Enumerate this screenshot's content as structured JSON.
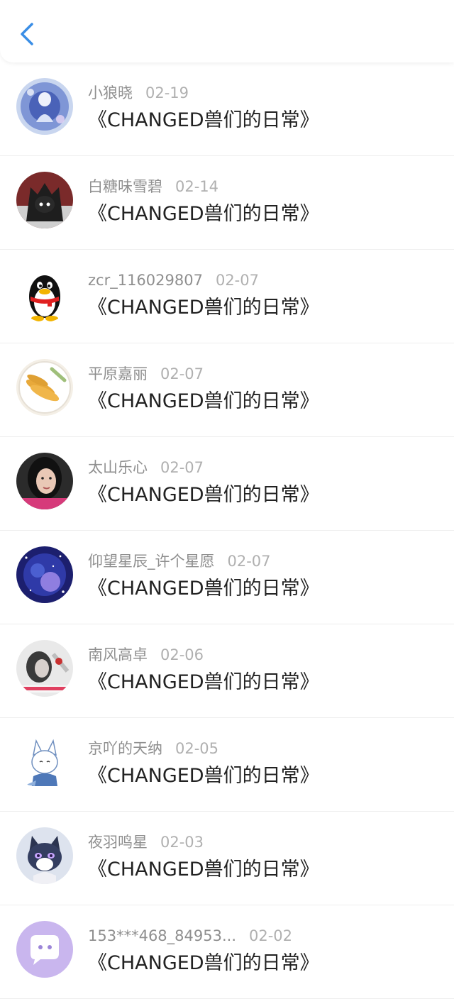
{
  "header": {
    "back_icon": "chevron-left-icon",
    "accent_color": "#3a8ee6"
  },
  "items": [
    {
      "name": "小狼晓",
      "date": "02-19",
      "title": "《CHANGED兽们的日常》",
      "avatar": "fantasy-character-avatar"
    },
    {
      "name": "白糖味雪碧",
      "date": "02-14",
      "title": "《CHANGED兽们的日常》",
      "avatar": "dark-creature-avatar"
    },
    {
      "name": "zcr_116029807",
      "date": "02-07",
      "title": "《CHANGED兽们的日常》",
      "avatar": "penguin-avatar"
    },
    {
      "name": "平原嘉丽",
      "date": "02-07",
      "title": "《CHANGED兽们的日常》",
      "avatar": "food-plate-avatar"
    },
    {
      "name": "太山乐心",
      "date": "02-07",
      "title": "《CHANGED兽们的日常》",
      "avatar": "portrait-photo-avatar"
    },
    {
      "name": "仰望星辰_许个星愿",
      "date": "02-07",
      "title": "《CHANGED兽们的日常》",
      "avatar": "starry-night-avatar"
    },
    {
      "name": "南风高卓",
      "date": "02-06",
      "title": "《CHANGED兽们的日常》",
      "avatar": "bw-photo-avatar"
    },
    {
      "name": "京吖的天纳",
      "date": "02-05",
      "title": "《CHANGED兽们的日常》",
      "avatar": "white-fox-avatar"
    },
    {
      "name": "夜羽鸣星",
      "date": "02-03",
      "title": "《CHANGED兽们的日常》",
      "avatar": "wolf-avatar"
    },
    {
      "name": "153***468_84953...",
      "date": "02-02",
      "title": "《CHANGED兽们的日常》",
      "avatar": "chat-bubble-avatar"
    }
  ]
}
